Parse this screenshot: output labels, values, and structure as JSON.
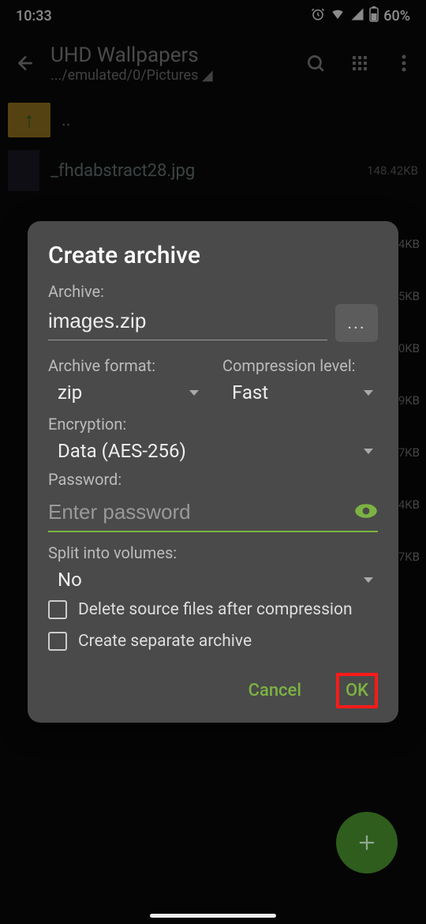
{
  "status": {
    "time": "10:33",
    "battery": "60%"
  },
  "appbar": {
    "title": "UHD Wallpapers",
    "path": ".../emulated/0/Pictures"
  },
  "files": {
    "up": "..",
    "row1": {
      "name": "_fhdabstract28.jpg",
      "size": "148.42KB"
    }
  },
  "bg_sizes": [
    "4KB",
    "5KB",
    "0KB",
    "9KB",
    "7KB",
    "4KB",
    "7KB"
  ],
  "dialog": {
    "title": "Create archive",
    "archive_label": "Archive:",
    "archive_value": "images.zip",
    "format_label": "Archive format:",
    "format_value": "zip",
    "compression_label": "Compression level:",
    "compression_value": "Fast",
    "encryption_label": "Encryption:",
    "encryption_value": "Data (AES-256)",
    "password_label": "Password:",
    "password_placeholder": "Enter password",
    "split_label": "Split into volumes:",
    "split_value": "No",
    "chk_delete": "Delete source files after compression",
    "chk_separate": "Create separate archive",
    "cancel": "Cancel",
    "ok": "OK"
  }
}
